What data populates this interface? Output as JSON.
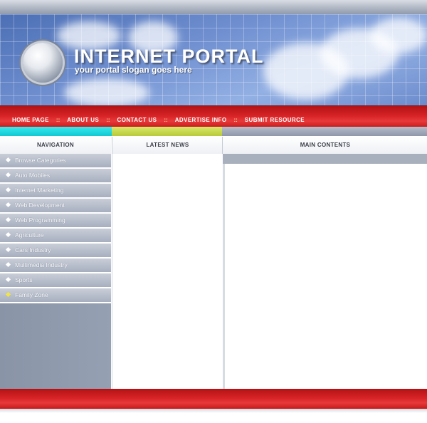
{
  "header": {
    "title": "INTERNET PORTAL",
    "slogan": "your portal slogan goes here"
  },
  "nav": {
    "links": [
      {
        "label": "HOME PAGE"
      },
      {
        "label": "ABOUT US"
      },
      {
        "label": "CONTACT US"
      },
      {
        "label": "ADVERTISE INFO"
      },
      {
        "label": "SUBMIT RESOURCE"
      }
    ],
    "separator": "::"
  },
  "columns": {
    "navigation": "NAVIGATION",
    "latest_news": "LATEST NEWS",
    "main_contents": "MAIN CONTENTS"
  },
  "sidebar": {
    "items": [
      {
        "label": "Browse Categories"
      },
      {
        "label": "Auto Mobiles"
      },
      {
        "label": "Internet Marketing"
      },
      {
        "label": "Web Development"
      },
      {
        "label": "Web Programming"
      },
      {
        "label": "Agriculture"
      },
      {
        "label": "Cars Industry"
      },
      {
        "label": "Multimedia Industry"
      },
      {
        "label": "Sports"
      },
      {
        "label": "Family Zone"
      }
    ]
  },
  "colors": {
    "nav_red": "#d62326",
    "accent_cyan": "#12c8d2",
    "accent_yellow": "#b8ca38",
    "sidebar_gray": "#8a94a7"
  },
  "icons": {
    "logo": "globe-orb-icon",
    "sidebar_bullet": "diamond-bullet-icon"
  }
}
